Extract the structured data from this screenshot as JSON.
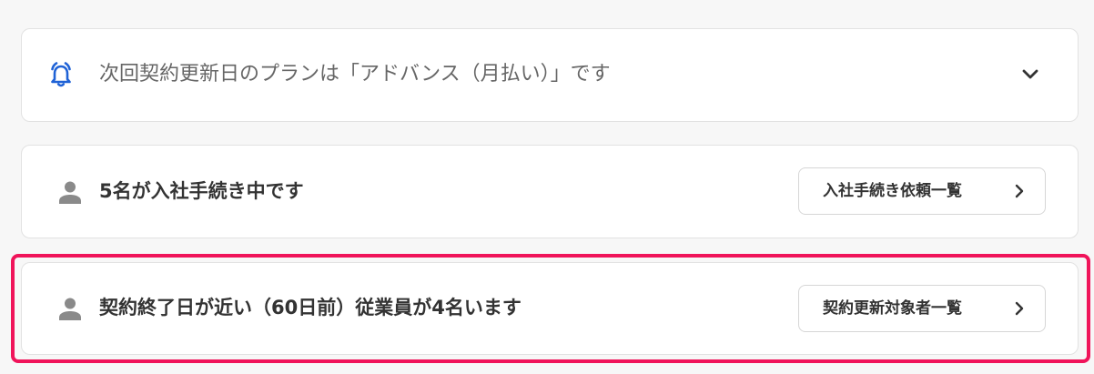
{
  "colors": {
    "accent": "#1f62d6",
    "highlight": "#f0145a",
    "icon_gray": "#8a8a8a",
    "text_dark": "#333333",
    "text_muted": "#666666"
  },
  "plan_notice": {
    "icon": "bell-icon",
    "text": "次回契約更新日のプランは「アドバンス（月払い）」です",
    "toggle_icon": "chevron-down-icon"
  },
  "onboarding": {
    "icon": "person-icon",
    "text": "5名が入社手続き中です",
    "button_label": "入社手続き依頼一覧",
    "button_icon": "chevron-right-icon"
  },
  "contract_expiry": {
    "icon": "person-icon",
    "text": "契約終了日が近い（60日前）従業員が4名います",
    "button_label": "契約更新対象者一覧",
    "button_icon": "chevron-right-icon"
  }
}
